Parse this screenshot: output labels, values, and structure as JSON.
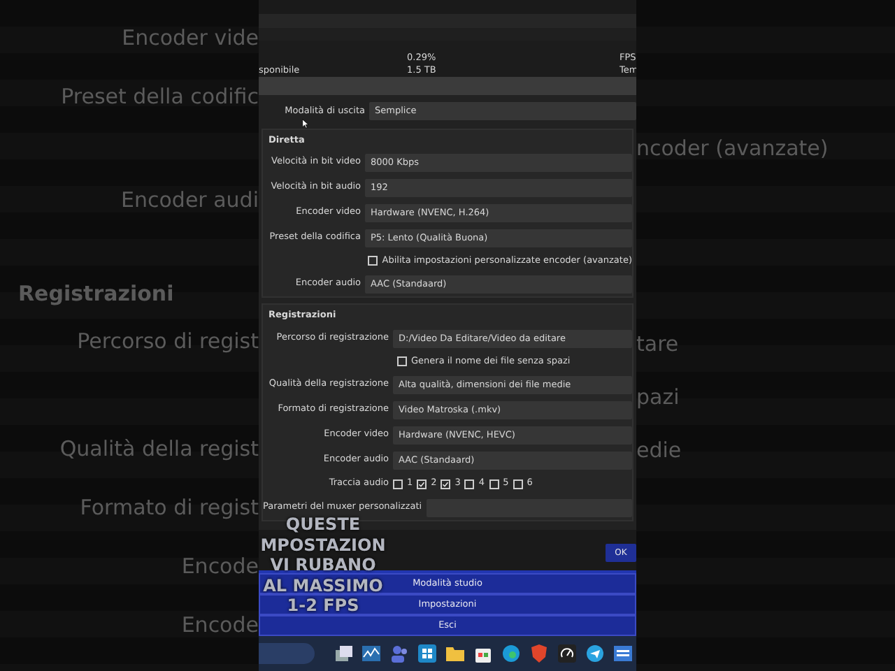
{
  "background_left": {
    "items": [
      {
        "text": "Encoder vide",
        "kind": "label"
      },
      {
        "text": "Preset della codific",
        "kind": "label"
      },
      {
        "text": "Encoder audi",
        "kind": "label"
      },
      {
        "text": "Registrazioni",
        "kind": "heading"
      },
      {
        "text": "Percorso di regist",
        "kind": "label"
      },
      {
        "text": "Qualità della regist",
        "kind": "label"
      },
      {
        "text": "Formato di regist",
        "kind": "label"
      },
      {
        "text": "Encode",
        "kind": "label"
      },
      {
        "text": "Encode",
        "kind": "label"
      }
    ]
  },
  "background_right": {
    "items": [
      {
        "text": "ncoder (avanzate)"
      },
      {
        "text": "tare"
      },
      {
        "text": "pazi"
      },
      {
        "text": "edie"
      }
    ]
  },
  "stats": [
    {
      "value": "0.29%",
      "column_3": "FPS"
    },
    {
      "label": "sponibile",
      "value": "1.5 TB",
      "column_3": "Tem"
    }
  ],
  "output_mode": {
    "label": "Modalità di uscita",
    "value": "Semplice"
  },
  "groups": [
    {
      "title": "Diretta",
      "rows": [
        {
          "kind": "field",
          "label": "Velocità in bit video",
          "value": "8000 Kbps"
        },
        {
          "kind": "field",
          "label": "Velocità in bit audio",
          "value": "192"
        },
        {
          "kind": "field",
          "label": "Encoder video",
          "value": "Hardware (NVENC, H.264)"
        },
        {
          "kind": "field",
          "label": "Preset della codifica",
          "value": "P5: Lento (Qualità Buona)"
        },
        {
          "kind": "checkbox",
          "label": "Abilita impostazioni personalizzate encoder (avanzate)",
          "checked": false
        },
        {
          "kind": "field",
          "label": "Encoder audio",
          "value": "AAC (Standaard)"
        }
      ]
    },
    {
      "title": "Registrazioni",
      "rows": [
        {
          "kind": "field",
          "label": "Percorso di registrazione",
          "value": "D:/Video Da Editare/Video da editare"
        },
        {
          "kind": "checkbox",
          "label": "Genera il nome dei file senza spazi",
          "checked": false
        },
        {
          "kind": "field",
          "label": "Qualità della registrazione",
          "value": "Alta qualità, dimensioni dei file medie"
        },
        {
          "kind": "field",
          "label": "Formato di registrazione",
          "value": "Video Matroska (.mkv)"
        },
        {
          "kind": "field",
          "label": "Encoder video",
          "value": "Hardware (NVENC, HEVC)"
        },
        {
          "kind": "field",
          "label": "Encoder audio",
          "value": "AAC (Standaard)"
        },
        {
          "kind": "tracks",
          "label": "Traccia audio",
          "tracks": [
            {
              "label": "1",
              "checked": false
            },
            {
              "label": "2",
              "checked": true
            },
            {
              "label": "3",
              "checked": true
            },
            {
              "label": "4",
              "checked": false
            },
            {
              "label": "5",
              "checked": false
            },
            {
              "label": "6",
              "checked": false
            }
          ]
        },
        {
          "kind": "field",
          "label": "Parametri del muxer personalizzati"
        }
      ]
    }
  ],
  "ok_button": "OK",
  "menu": [
    {
      "label": "Modalità studio"
    },
    {
      "label": "Impostazioni"
    },
    {
      "label": "Esci"
    }
  ],
  "caption": [
    "QUESTE",
    "MPOSTAZION",
    "VI RUBANO",
    "AL MASSIMO",
    "1-2 FPS"
  ]
}
